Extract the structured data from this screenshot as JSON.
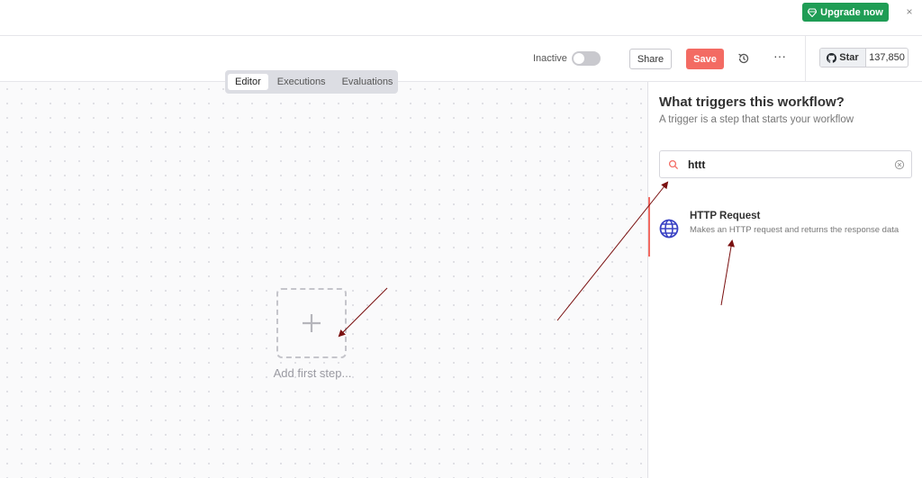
{
  "banner": {
    "upgrade_label": "Upgrade now",
    "close_glyph": "×",
    "upgrade_color": "#1f9d55"
  },
  "header": {
    "status_label": "Inactive",
    "share_label": "Share",
    "save_label": "Save",
    "more_glyph": "···",
    "github": {
      "star_label": "Star",
      "count": "137,850"
    },
    "save_color": "#f36b63"
  },
  "tabs": [
    {
      "label": "Editor",
      "active": true
    },
    {
      "label": "Executions",
      "active": false
    },
    {
      "label": "Evaluations",
      "active": false
    }
  ],
  "canvas": {
    "add_step_label": "Add first step..."
  },
  "panel": {
    "title": "What triggers this workflow?",
    "subtitle": "A trigger is a step that starts your workflow",
    "search": {
      "value": "httt"
    },
    "results": [
      {
        "title": "HTTP Request",
        "description": "Makes an HTTP request and returns the response data",
        "icon": "globe-icon"
      }
    ]
  },
  "annotations": {
    "arrow_color": "#7a1010"
  }
}
